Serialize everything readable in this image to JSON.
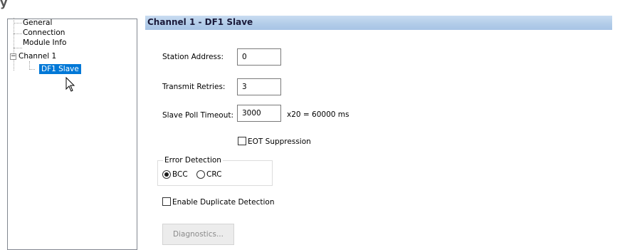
{
  "top_title": "y",
  "tree": {
    "items": [
      {
        "label": "General"
      },
      {
        "label": "Connection"
      },
      {
        "label": "Module Info"
      },
      {
        "label": "Channel 1",
        "expander": "−"
      },
      {
        "label": "DF1 Slave"
      }
    ]
  },
  "header": {
    "title": "Channel 1 - DF1 Slave"
  },
  "form": {
    "station_address_label": "Station Address:",
    "station_address_value": "0",
    "transmit_retries_label": "Transmit Retries:",
    "transmit_retries_value": "3",
    "slave_poll_timeout_label": "Slave Poll Timeout:",
    "slave_poll_timeout_value": "3000",
    "timeout_calc": "x20 =  60000 ms",
    "eot_label": "EOT Suppression",
    "eot_checked": false,
    "error_detection_label": "Error Detection",
    "bcc_label": "BCC",
    "crc_label": "CRC",
    "selected_error_detection": "BCC",
    "duplicate_label": "Enable Duplicate Detection",
    "duplicate_checked": false,
    "diagnostics_label": "Diagnostics..."
  },
  "icons": {
    "cursor": "mouse-pointer-icon",
    "expander": "tree-collapse-icon"
  },
  "colors": {
    "selection": "#0078d7",
    "header_gradient": "#b3cde9",
    "disabled_text": "#8a8a8a"
  }
}
